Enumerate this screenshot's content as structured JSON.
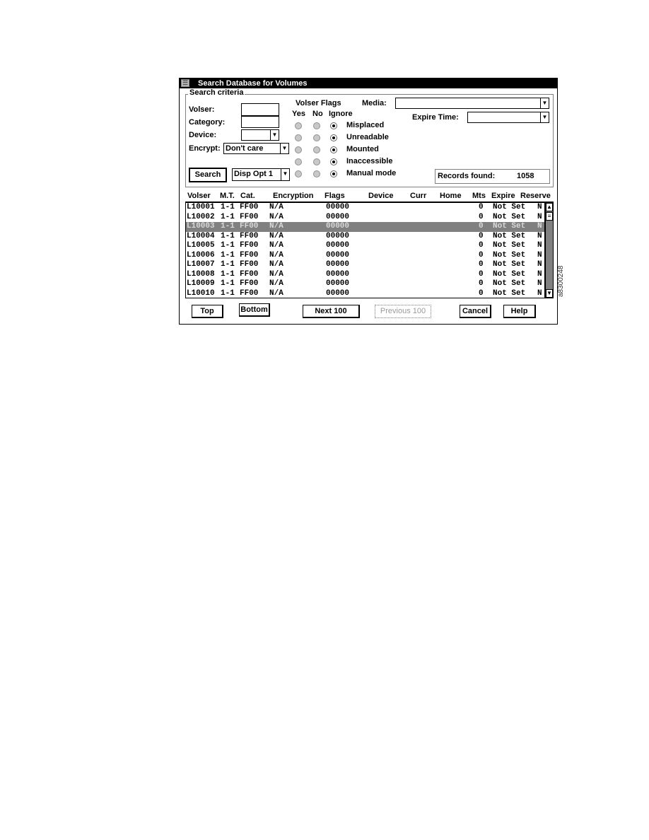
{
  "window": {
    "title": "Search Database for Volumes",
    "system_menu_icon": "system-menu-icon"
  },
  "search_criteria": {
    "group_label": "Search criteria",
    "volser_label": "Volser:",
    "volser_value": "",
    "category_label": "Category:",
    "category_value": "",
    "device_label": "Device:",
    "device_value": "",
    "encrypt_label": "Encrypt:",
    "encrypt_value": "Don't care",
    "search_button": "Search",
    "display_option_value": "Disp Opt 1",
    "media_label": "Media:",
    "media_value": "",
    "expire_time_label": "Expire Time:",
    "expire_time_value": "",
    "records_found_label": "Records found:",
    "records_found_value": "1058"
  },
  "volser_flags": {
    "title": "Volser Flags",
    "columns": [
      "Yes",
      "No",
      "Ignore"
    ],
    "flags": [
      {
        "name": "Misplaced",
        "selected": "Ignore"
      },
      {
        "name": "Unreadable",
        "selected": "Ignore"
      },
      {
        "name": "Mounted",
        "selected": "Ignore"
      },
      {
        "name": "Inaccessible",
        "selected": "Ignore"
      },
      {
        "name": "Manual mode",
        "selected": "Ignore"
      }
    ]
  },
  "table": {
    "headers": [
      "Volser",
      "M.T.",
      "Cat.",
      "Encryption",
      "Flags",
      "Device",
      "Curr",
      "Home",
      "Mts",
      "Expire",
      "Reserve"
    ],
    "selected_index": 2,
    "rows": [
      [
        "L10001",
        "1-1",
        "FF00",
        "N/A",
        "00000",
        "",
        "",
        "",
        "0",
        "Not Set",
        "N"
      ],
      [
        "L10002",
        "1-1",
        "FF00",
        "N/A",
        "00000",
        "",
        "",
        "",
        "0",
        "Not Set",
        "N"
      ],
      [
        "L10003",
        "1-1",
        "FF00",
        "N/A",
        "00000",
        "",
        "",
        "",
        "0",
        "Not Set",
        "N"
      ],
      [
        "L10004",
        "1-1",
        "FF00",
        "N/A",
        "00000",
        "",
        "",
        "",
        "0",
        "Not Set",
        "N"
      ],
      [
        "L10005",
        "1-1",
        "FF00",
        "N/A",
        "00000",
        "",
        "",
        "",
        "0",
        "Not Set",
        "N"
      ],
      [
        "L10006",
        "1-1",
        "FF00",
        "N/A",
        "00000",
        "",
        "",
        "",
        "0",
        "Not Set",
        "N"
      ],
      [
        "L10007",
        "1-1",
        "FF00",
        "N/A",
        "00000",
        "",
        "",
        "",
        "0",
        "Not Set",
        "N"
      ],
      [
        "L10008",
        "1-1",
        "FF00",
        "N/A",
        "00000",
        "",
        "",
        "",
        "0",
        "Not Set",
        "N"
      ],
      [
        "L10009",
        "1-1",
        "FF00",
        "N/A",
        "00000",
        "",
        "",
        "",
        "0",
        "Not Set",
        "N"
      ],
      [
        "L10010",
        "1-1",
        "FF00",
        "N/A",
        "00000",
        "",
        "",
        "",
        "0",
        "Not Set",
        "N"
      ]
    ]
  },
  "buttons": {
    "top": "Top",
    "bottom": "Bottom",
    "next": "Next 100",
    "previous": "Previous 100",
    "cancel": "Cancel",
    "help": "Help"
  },
  "figure_id": "a8300248"
}
